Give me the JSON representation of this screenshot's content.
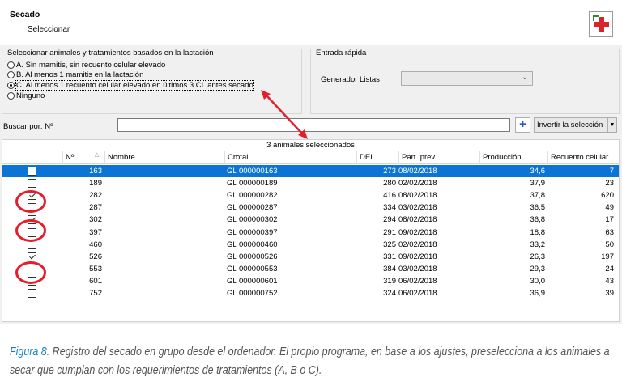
{
  "window": {
    "title": "Secado",
    "subtitle": "Seleccionar"
  },
  "toolbar": {
    "add_icon": "medical-plus-icon"
  },
  "selection_group": {
    "legend": "Seleccionar animales y tratamientos basados en la lactación",
    "options": [
      {
        "label": "A. Sin mamitis, sin recuento celular elevado",
        "selected": false
      },
      {
        "label": "B. Al menos 1 mamitis en la lactación",
        "selected": false
      },
      {
        "label": "C. Al menos 1 recuento celular elevado en últimos 3 CL antes secado",
        "selected": true
      },
      {
        "label": "Ninguno",
        "selected": false
      }
    ]
  },
  "quick_entry": {
    "legend": "Entrada rápida",
    "generator_label": "Generador Listas",
    "generator_value": ""
  },
  "search": {
    "label": "Buscar por: Nº",
    "value": "",
    "add_label": "+",
    "invert_label": "Invertir la selección"
  },
  "grid": {
    "caption": "3 animales seleccionados",
    "columns": [
      "Nº.",
      "Nombre",
      "Crotal",
      "DEL",
      "Part. prev.",
      "Producción",
      "Recuento celular"
    ],
    "rows": [
      {
        "checked": false,
        "no": "163",
        "nombre": "",
        "crotal": "GL 000000163",
        "del": "273",
        "part": "08/02/2018",
        "prod": "34,6",
        "rc": "7",
        "highlighted": true
      },
      {
        "checked": false,
        "no": "189",
        "nombre": "",
        "crotal": "GL 000000189",
        "del": "280",
        "part": "02/02/2018",
        "prod": "37,9",
        "rc": "23",
        "highlighted": false
      },
      {
        "checked": true,
        "no": "282",
        "nombre": "",
        "crotal": "GL 000000282",
        "del": "416",
        "part": "08/02/2018",
        "prod": "37,8",
        "rc": "620",
        "highlighted": false
      },
      {
        "checked": false,
        "no": "287",
        "nombre": "",
        "crotal": "GL 000000287",
        "del": "334",
        "part": "03/02/2018",
        "prod": "36,5",
        "rc": "49",
        "highlighted": false
      },
      {
        "checked": true,
        "no": "302",
        "nombre": "",
        "crotal": "GL 000000302",
        "del": "294",
        "part": "08/02/2018",
        "prod": "36,8",
        "rc": "17",
        "highlighted": false
      },
      {
        "checked": false,
        "no": "397",
        "nombre": "",
        "crotal": "GL 000000397",
        "del": "291",
        "part": "09/02/2018",
        "prod": "18,8",
        "rc": "63",
        "highlighted": false
      },
      {
        "checked": false,
        "no": "460",
        "nombre": "",
        "crotal": "GL 000000460",
        "del": "325",
        "part": "02/02/2018",
        "prod": "33,2",
        "rc": "50",
        "highlighted": false
      },
      {
        "checked": true,
        "no": "526",
        "nombre": "",
        "crotal": "GL 000000526",
        "del": "331",
        "part": "09/02/2018",
        "prod": "26,3",
        "rc": "197",
        "highlighted": false
      },
      {
        "checked": false,
        "no": "553",
        "nombre": "",
        "crotal": "GL 000000553",
        "del": "384",
        "part": "03/02/2018",
        "prod": "29,3",
        "rc": "24",
        "highlighted": false
      },
      {
        "checked": false,
        "no": "601",
        "nombre": "",
        "crotal": "GL 000000601",
        "del": "319",
        "part": "06/02/2018",
        "prod": "30,0",
        "rc": "43",
        "highlighted": false
      },
      {
        "checked": false,
        "no": "752",
        "nombre": "",
        "crotal": "GL 000000752",
        "del": "324",
        "part": "06/02/2018",
        "prod": "36,9",
        "rc": "39",
        "highlighted": false
      }
    ]
  },
  "annotation_color": "#e41e2b",
  "figure_caption": {
    "label": "Figura 8.",
    "text": " Registro del secado en grupo desde el ordenador. El propio programa, en base a los ajustes, preselecciona a los animales a secar que cumplan con los requerimientos de tratamientos (A, B o C)."
  }
}
